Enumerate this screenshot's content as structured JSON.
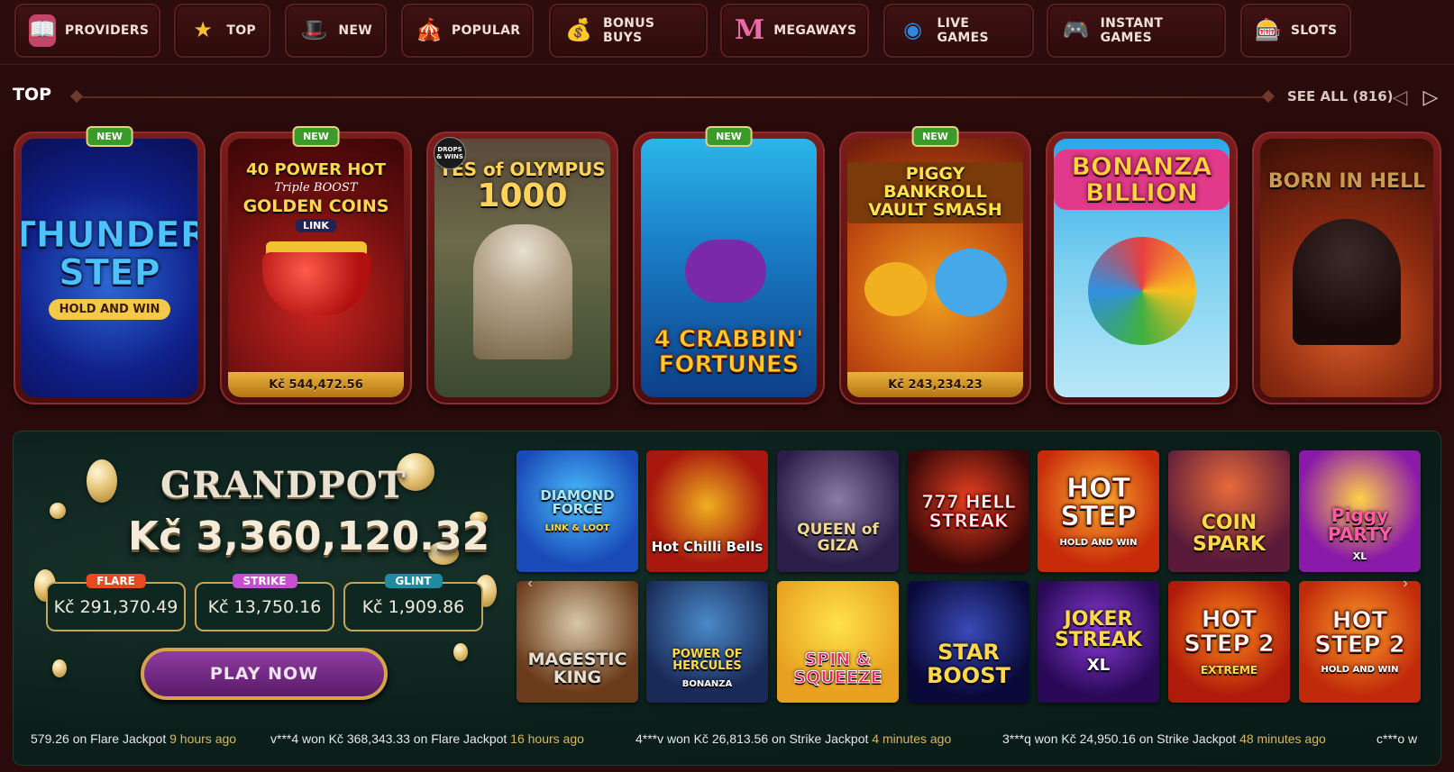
{
  "nav": [
    {
      "label": "PROVIDERS",
      "icon": "book-icon"
    },
    {
      "label": "TOP",
      "icon": "star-icon"
    },
    {
      "label": "NEW",
      "icon": "magic-hat-icon"
    },
    {
      "label": "POPULAR",
      "icon": "jester-hat-icon"
    },
    {
      "label": "BONUS BUYS",
      "icon": "money-bag-icon"
    },
    {
      "label": "MEGAWAYS",
      "icon": "megaways-m-icon"
    },
    {
      "label": "LIVE GAMES",
      "icon": "casino-chip-icon"
    },
    {
      "label": "INSTANT GAMES",
      "icon": "joystick-icon"
    },
    {
      "label": "SLOTS",
      "icon": "slot-reels-icon"
    }
  ],
  "top": {
    "title": "TOP",
    "see_all": "SEE ALL (816)",
    "prev_icon": "chevron-left-icon",
    "next_icon": "chevron-right-icon",
    "new_badge": "NEW",
    "cards": [
      {
        "title": "THUNDER STEP",
        "subtitle": "HOLD AND WIN",
        "new": true,
        "jackpot": ""
      },
      {
        "title": "40 POWER HOT",
        "subtitle": "Triple BOOST",
        "subtitle2": "GOLDEN COINS",
        "subtitle3": "LINK",
        "new": true,
        "jackpot": "Kč 544,472.56"
      },
      {
        "title": "TES of OLYMPUS",
        "subtitle": "1000",
        "corner": "DROPS & WINS",
        "new": false,
        "jackpot": ""
      },
      {
        "title": "4 CRABBIN' FORTUNES",
        "new": true,
        "jackpot": ""
      },
      {
        "title": "PIGGY BANKROLL VAULT SMASH",
        "new": true,
        "jackpot": "Kč 243,234.23"
      },
      {
        "title": "BONANZA BILLION",
        "new": false,
        "jackpot": ""
      },
      {
        "title": "BORN IN HELL",
        "new": false,
        "jackpot": ""
      }
    ]
  },
  "grandpot": {
    "title": "GRANDPOT",
    "amount": "Kč 3,360,120.32",
    "tiers": [
      {
        "label": "FLARE",
        "value": "Kč 291,370.49",
        "color": "#e8491e"
      },
      {
        "label": "STRIKE",
        "value": "Kč 13,750.16",
        "color": "#c64fd1"
      },
      {
        "label": "GLINT",
        "value": "Kč 1,909.86",
        "color": "#1f8aa0"
      }
    ],
    "play": "PLAY NOW"
  },
  "tiles": [
    {
      "title": "DIAMOND FORCE",
      "sub": "LINK & LOOT"
    },
    {
      "title": "Hot Chilli Bells"
    },
    {
      "title": "QUEEN of GIZA"
    },
    {
      "title": "777 HELL STREAK"
    },
    {
      "title": "HOT STEP",
      "sub": "HOLD AND WIN"
    },
    {
      "title": "COIN SPARK"
    },
    {
      "title": "Piggy PARTY",
      "sub": "XL"
    },
    {
      "title": "MAGESTIC KING"
    },
    {
      "title": "POWER OF HERCULES",
      "sub": "BONANZA"
    },
    {
      "title": "SPIN & SQUEEZE"
    },
    {
      "title": "STAR BOOST"
    },
    {
      "title": "JOKER STREAK",
      "sub": "XL"
    },
    {
      "title": "HOT STEP 2",
      "sub": "EXTREME"
    },
    {
      "title": "HOT STEP 2",
      "sub": "HOLD AND WIN"
    }
  ],
  "tile_prev_icon": "chevron-left-icon",
  "tile_next_icon": "chevron-right-icon",
  "ticker": [
    {
      "text": "579.26 on Flare Jackpot",
      "ago": "9 hours ago"
    },
    {
      "text": "v***4 won Kč 368,343.33 on Flare Jackpot",
      "ago": "16 hours ago"
    },
    {
      "text": "4***v won Kč 26,813.56 on Strike Jackpot",
      "ago": "4 minutes ago"
    },
    {
      "text": "3***q won Kč 24,950.16 on Strike Jackpot",
      "ago": "48 minutes ago"
    },
    {
      "text": "c***o w",
      "ago": ""
    }
  ]
}
